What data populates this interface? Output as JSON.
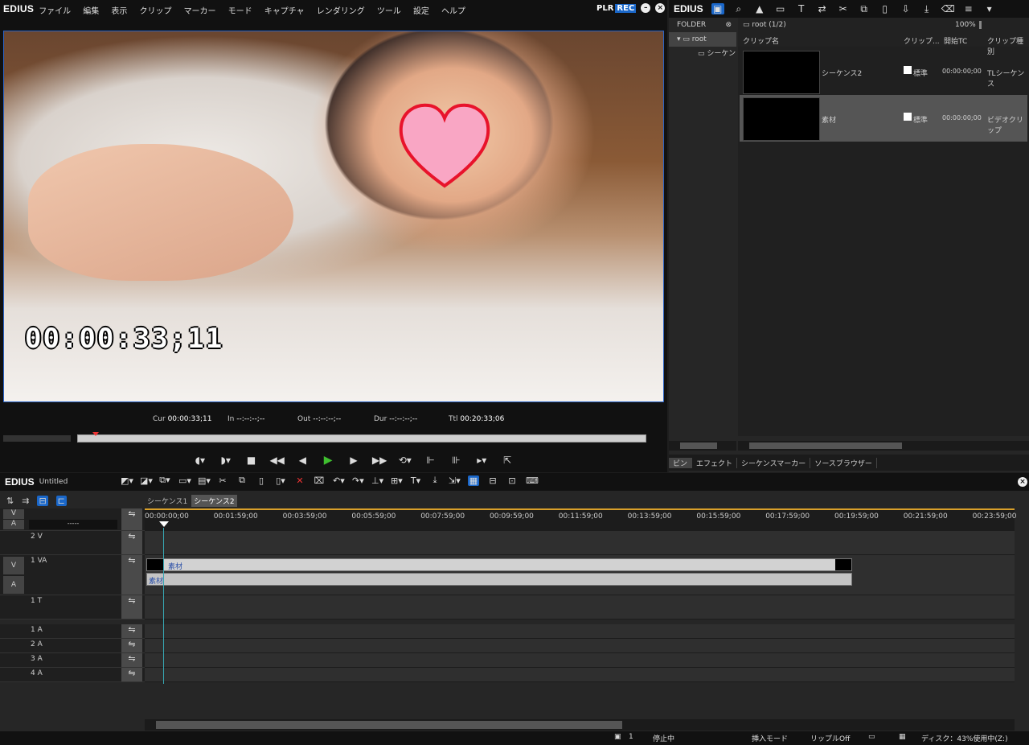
{
  "player": {
    "app": "EDIUS",
    "menu": [
      "ファイル",
      "編集",
      "表示",
      "クリップ",
      "マーカー",
      "モード",
      "キャプチャ",
      "レンダリング",
      "ツール",
      "設定",
      "ヘルプ"
    ],
    "plr": "PLR",
    "rec": "REC",
    "overlay_tc": "00:00:33;11",
    "cur_label": "Cur",
    "cur_val": "00:00:33;11",
    "in_label": "In",
    "in_val": "--:--:--;--",
    "out_label": "Out",
    "out_val": "--:--:--;--",
    "dur_label": "Dur",
    "dur_val": "--:--:--;--",
    "ttl_label": "Ttl",
    "ttl_val": "00:20:33;06"
  },
  "bin": {
    "app": "EDIUS",
    "folder_header": "FOLDER",
    "folder_root": "root",
    "folder_child": "シーケン",
    "path": "root (1/2)",
    "zoom": "100%",
    "columns": [
      "クリップ名",
      "クリップ...",
      "開始TC",
      "クリップ種別"
    ],
    "clips": [
      {
        "name": "シーケンス2",
        "mark": "標準",
        "tc": "00:00:00;00",
        "type": "TLシーケンス"
      },
      {
        "name": "素材",
        "mark": "標準",
        "tc": "00:00:00;00",
        "type": "ビデオクリップ"
      }
    ],
    "tabs": [
      "ビン",
      "エフェクト",
      "シーケンスマーカー",
      "ソースブラウザー"
    ]
  },
  "timeline": {
    "app": "EDIUS",
    "project": "Untitled",
    "sequences": [
      "シーケンス1",
      "シーケンス2"
    ],
    "ruler": [
      "00:00:00;00",
      "00:01:59;00",
      "00:03:59;00",
      "00:05:59;00",
      "00:07:59;00",
      "00:09:59;00",
      "00:11:59;00",
      "00:13:59;00",
      "00:15:59;00",
      "00:17:59;00",
      "00:19:59;00",
      "00:21:59;00",
      "00:23:59;00"
    ],
    "patch_v": "V",
    "patch_a": "A",
    "patch_sel": "-----",
    "tracks": [
      "2 V",
      "1 VA",
      "1 T",
      "1 A",
      "2 A",
      "3 A",
      "4 A"
    ],
    "va_v": "V",
    "va_a": "A",
    "clip_v": "素材",
    "clip_a": "素材"
  },
  "status": {
    "count": "1",
    "state": "停止中",
    "mode": "挿入モード",
    "ripple": "リップルOff",
    "disk": "ディスク：43%使用中(Z:)"
  }
}
